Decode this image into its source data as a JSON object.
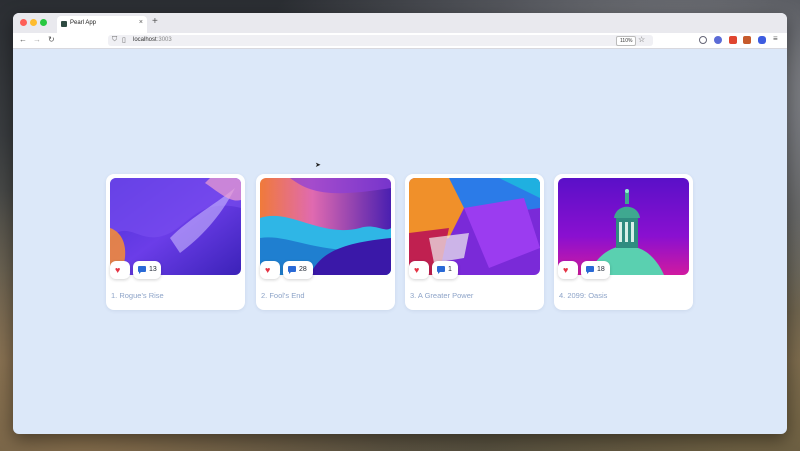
{
  "browser": {
    "tab_title": "Pearl App",
    "tab_close": "×",
    "new_tab": "+",
    "url_host": "localhost",
    "url_port": ":3003",
    "zoom": "110%",
    "nav": {
      "back": "←",
      "forward": "→",
      "reload": "↻"
    },
    "star": "☆"
  },
  "cards": [
    {
      "title": "1. Rogue's Rise",
      "comments": "13",
      "heart": "♥"
    },
    {
      "title": "2. Fool's End",
      "comments": "28",
      "heart": "♥"
    },
    {
      "title": "3. A Greater Power",
      "comments": "1",
      "heart": "♥"
    },
    {
      "title": "4. 2099: Oasis",
      "comments": "18",
      "heart": "♥"
    }
  ],
  "colors": {
    "page_bg": "#dce8f9",
    "heart": "#e53344",
    "comment": "#2969d6",
    "title": "#8ea4c8"
  }
}
